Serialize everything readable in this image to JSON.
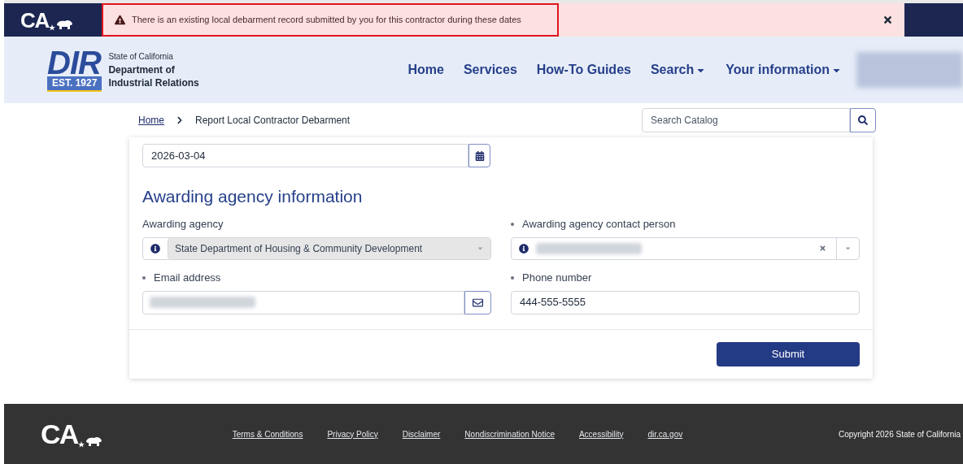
{
  "top_bar": {
    "logo_text": "CA",
    "alert": {
      "message": "There is an existing local debarment record submitted by you for this contractor during these dates",
      "highlighted": true
    }
  },
  "header": {
    "logo": {
      "letters": "DIR",
      "established": "EST. 1927",
      "state": "State of California",
      "department_line_1": "Department of",
      "department_line_2": "Industrial Relations"
    },
    "nav": [
      {
        "label": "Home",
        "dropdown": false
      },
      {
        "label": "Services",
        "dropdown": false
      },
      {
        "label": "How-To Guides",
        "dropdown": false
      },
      {
        "label": "Search",
        "dropdown": true
      },
      {
        "label": "Your information",
        "dropdown": true
      }
    ]
  },
  "breadcrumb": [
    {
      "label": "Home",
      "link": true
    },
    {
      "label": "Report Local Contractor Debarment",
      "link": false
    }
  ],
  "search": {
    "placeholder": "Search Catalog"
  },
  "form": {
    "date_value": "2026-03-04",
    "section_title": "Awarding agency information",
    "fields": [
      {
        "kind": "select",
        "label": "Awarding agency",
        "required": false,
        "disabled": true,
        "value": "State Department of Housing & Community Development"
      },
      {
        "kind": "combobox",
        "label": "Awarding agency contact person",
        "required": true,
        "disabled": false
      },
      {
        "kind": "email",
        "label": "Email address",
        "required": true,
        "disabled": false
      },
      {
        "kind": "text",
        "label": "Phone number",
        "required": true,
        "disabled": false,
        "value": "444-555-5555"
      }
    ],
    "submit": "Submit"
  },
  "footer": {
    "logo_text": "CA",
    "links": [
      "Terms & Conditions",
      "Privacy Policy",
      "Disclaimer",
      "Nondiscrimination Notice",
      "Accessibility",
      "dir.ca.gov"
    ],
    "copyright": "Copyright 2026 State of California"
  }
}
